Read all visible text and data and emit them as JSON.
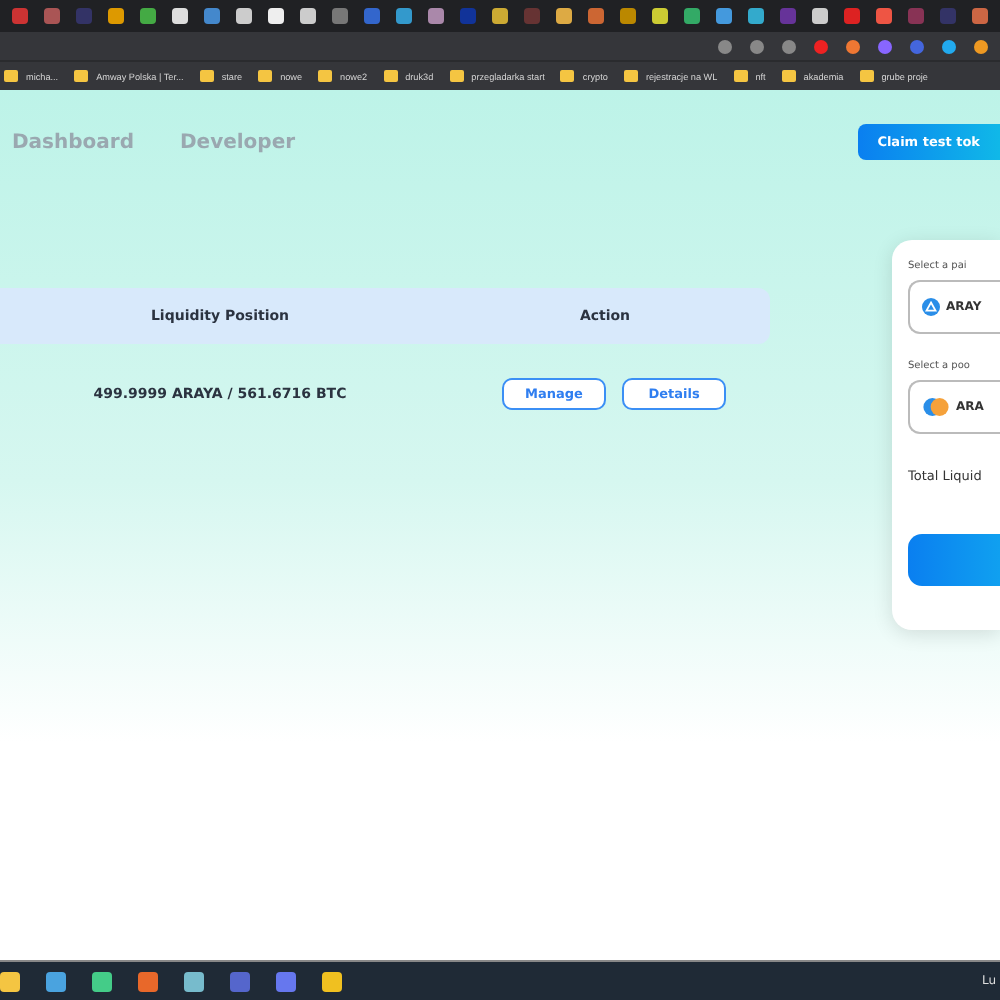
{
  "bookmarks": [
    {
      "label": "micha..."
    },
    {
      "label": "Amway Polska | Ter..."
    },
    {
      "label": "stare"
    },
    {
      "label": "nowe"
    },
    {
      "label": "nowe2"
    },
    {
      "label": "druk3d"
    },
    {
      "label": "przegladarka start"
    },
    {
      "label": "crypto"
    },
    {
      "label": "rejestracje na WL"
    },
    {
      "label": "nft"
    },
    {
      "label": "akademia"
    },
    {
      "label": "grube proje"
    }
  ],
  "nav": [
    {
      "label": "Dashboard"
    },
    {
      "label": "Developer"
    }
  ],
  "claim_button": "Claim test tok",
  "table": {
    "columns": [
      "Liquidity Position",
      "Action"
    ],
    "rows": [
      {
        "position": "499.9999 ARAYA / 561.6716 BTC",
        "actions": [
          "Manage",
          "Details"
        ]
      }
    ]
  },
  "panel": {
    "pair_label": "Select a pai",
    "pair_value": "ARAY",
    "pool_label": "Select a poo",
    "pool_value": "ARA",
    "total_label": "Total Liquid"
  },
  "taskbar": {
    "tray_text": "Lu"
  }
}
